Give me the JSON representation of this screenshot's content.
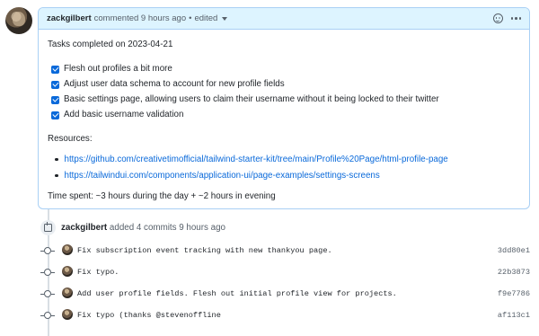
{
  "comment": {
    "author": "zackgilbert",
    "action": "commented",
    "time": "9 hours ago",
    "separator": "•",
    "edited": "edited",
    "title": "Tasks completed on 2023-04-21",
    "tasks": [
      {
        "label": "Flesh out profiles a bit more",
        "checked": true
      },
      {
        "label": "Adjust user data schema to account for new profile fields",
        "checked": true
      },
      {
        "label": "Basic settings page, allowing users to claim their username without it being locked to their twitter",
        "checked": true
      },
      {
        "label": "Add basic username validation",
        "checked": true
      }
    ],
    "resources_label": "Resources:",
    "links": [
      "https://github.com/creativetimofficial/tailwind-starter-kit/tree/main/Profile%20Page/html-profile-page",
      "https://tailwindui.com/components/application-ui/page-examples/settings-screens"
    ],
    "time_spent": "Time spent: ~3 hours during the day + ~2 hours in evening"
  },
  "commits_event": {
    "author": "zackgilbert",
    "action": "added 4 commits 9 hours ago"
  },
  "commits": [
    {
      "message": "Fix subscription event tracking with new thankyou page.",
      "sha": "3dd80e1"
    },
    {
      "message": "Fix typo.",
      "sha": "22b3873"
    },
    {
      "message": "Add user profile fields. Flesh out initial profile view for projects.",
      "sha": "f9e7786"
    },
    {
      "message": "Fix typo (thanks @stevenoffline",
      "sha": "af113c1"
    }
  ],
  "icons": {
    "reaction": "smiley-icon",
    "menu": "kebab-horizontal-icon",
    "commits": "repo-push-icon",
    "commit": "git-commit-icon"
  },
  "colors": {
    "accent": "#0969da",
    "header_bg": "#ddf4ff",
    "header_border": "#a9d0f5"
  }
}
